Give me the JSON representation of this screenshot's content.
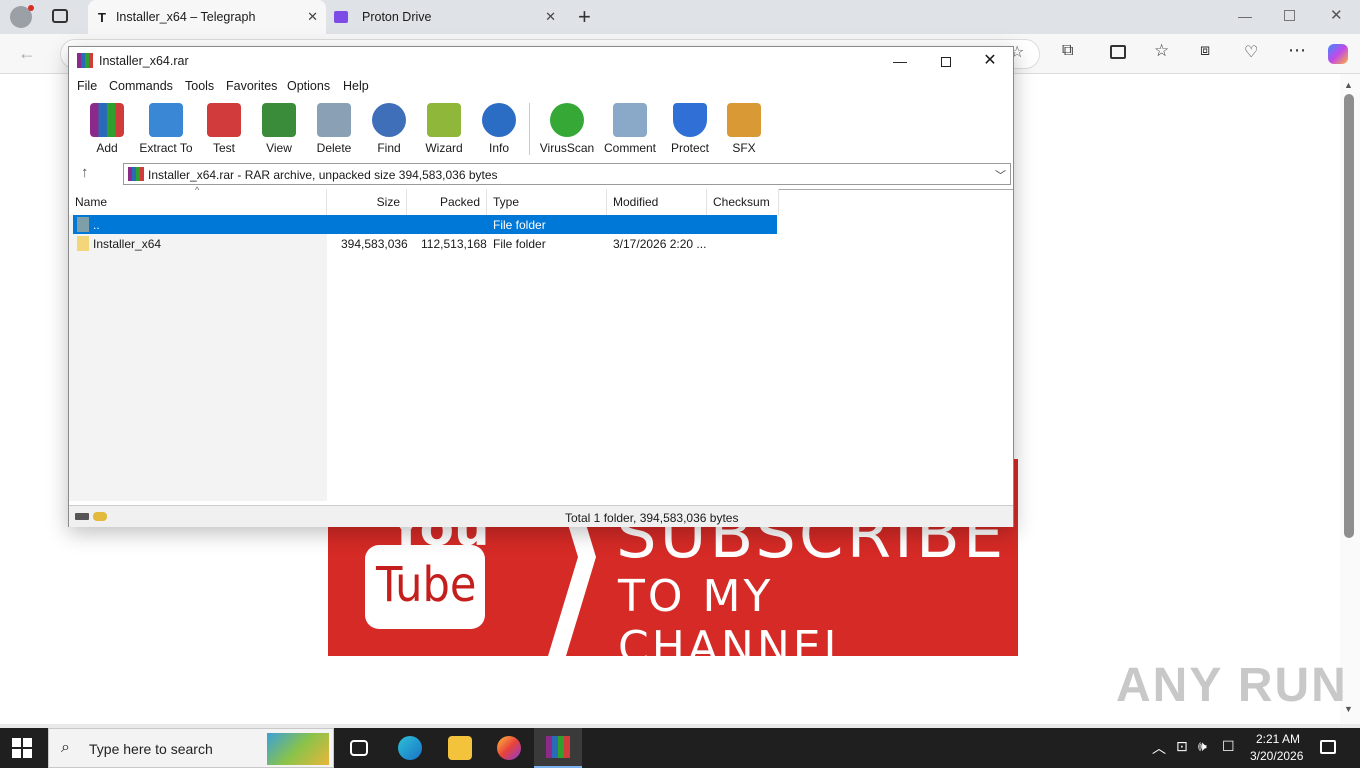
{
  "browser": {
    "tabs": [
      {
        "label": "Installer_x64 – Telegraph",
        "favicon": "T"
      },
      {
        "label": "Proton Drive"
      }
    ],
    "new_tab": "+"
  },
  "banner": {
    "you": "You",
    "tube": "Tube",
    "line1": "SUBSCRIBE",
    "line2": "TO MY CHANNEL"
  },
  "watermark": "ANY RUN",
  "winrar": {
    "title": "Installer_x64.rar",
    "menu": [
      "File",
      "Commands",
      "Tools",
      "Favorites",
      "Options",
      "Help"
    ],
    "tools": [
      {
        "label": "Add",
        "color": "#b8352a"
      },
      {
        "label": "Extract To",
        "color": "#3a87d6"
      },
      {
        "label": "Test",
        "color": "#d23b3b"
      },
      {
        "label": "View",
        "color": "#3a8c3a"
      },
      {
        "label": "Delete",
        "color": "#8aa0b4"
      },
      {
        "label": "Find",
        "color": "#3e6fb8"
      },
      {
        "label": "Wizard",
        "color": "#8fb83a"
      },
      {
        "label": "Info",
        "color": "#2b6cc4"
      },
      {
        "label": "VirusScan",
        "color": "#36a836"
      },
      {
        "label": "Comment",
        "color": "#8aa8c8"
      },
      {
        "label": "Protect",
        "color": "#2f6fd6"
      },
      {
        "label": "SFX",
        "color": "#d99a36"
      }
    ],
    "path": "Installer_x64.rar - RAR archive, unpacked size 394,583,036 bytes",
    "columns": [
      "Name",
      "Size",
      "Packed",
      "Type",
      "Modified",
      "Checksum"
    ],
    "rows": [
      {
        "name": "..",
        "size": "",
        "packed": "",
        "type": "File folder",
        "modified": "",
        "checksum": ""
      },
      {
        "name": "Installer_x64",
        "size": "394,583,036",
        "packed": "112,513,168",
        "type": "File folder",
        "modified": "3/17/2026 2:20 ...",
        "checksum": ""
      }
    ],
    "status": "Total 1 folder, 394,583,036 bytes"
  },
  "taskbar": {
    "search_placeholder": "Type here to search",
    "time": "2:21 AM",
    "date": "3/20/2026"
  }
}
